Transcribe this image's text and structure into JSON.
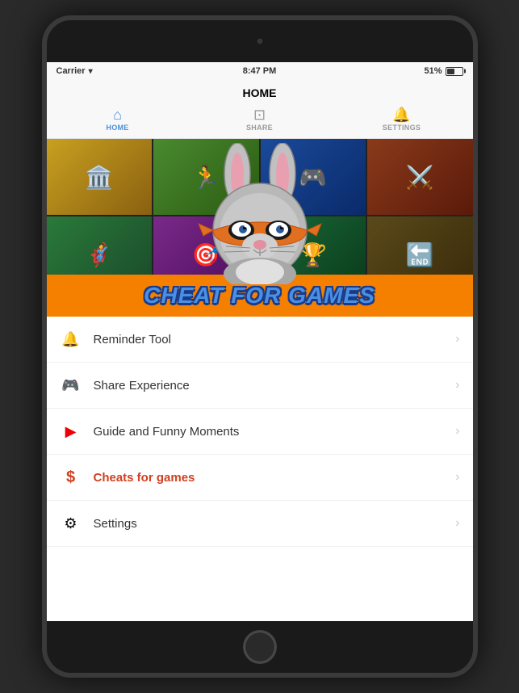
{
  "device": {
    "status_bar": {
      "carrier": "Carrier",
      "time": "8:47 PM",
      "battery_percent": "51%"
    },
    "nav": {
      "title": "HOME",
      "tabs": [
        {
          "id": "home",
          "label": "HOME",
          "icon": "🏠",
          "active": true
        },
        {
          "id": "share",
          "label": "SHARE",
          "icon": "🔗",
          "active": false
        },
        {
          "id": "settings",
          "label": "SETTINGS",
          "icon": "🔔",
          "active": false
        }
      ]
    },
    "hero": {
      "title_banner": "Cheat for Games"
    },
    "menu": {
      "items": [
        {
          "id": "reminder",
          "icon": "🔔",
          "label": "Reminder Tool",
          "active": false,
          "icon_color": "#333"
        },
        {
          "id": "share",
          "icon": "🎮",
          "label": "Share Experience",
          "active": false,
          "icon_color": "#333"
        },
        {
          "id": "guide",
          "icon": "▶",
          "label": "Guide and Funny Moments",
          "active": false,
          "icon_color": "#333"
        },
        {
          "id": "cheats",
          "icon": "$",
          "label": "Cheats for games",
          "active": true,
          "icon_color": "#d04020"
        },
        {
          "id": "settings",
          "icon": "⚙",
          "label": "Settings",
          "active": false,
          "icon_color": "#333"
        }
      ]
    }
  }
}
